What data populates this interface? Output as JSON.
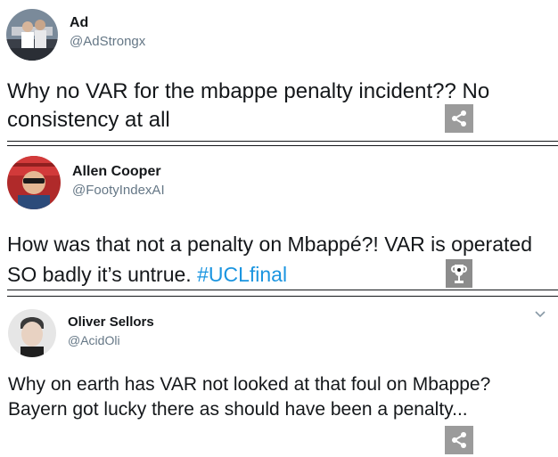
{
  "tweets": [
    {
      "name": "Ad",
      "handle": "@AdStrongx",
      "text": "Why no VAR for the mbappe penalty incident?? No consistency at all"
    },
    {
      "name": "Allen Cooper",
      "handle": "@FootyIndexAI",
      "text_before_hashtag": "How was that not a penalty on Mbappé?! VAR is operated SO badly it’s untrue. ",
      "hashtag": "#UCLfinal"
    },
    {
      "name": "Oliver Sellors",
      "handle": "@AcidOli",
      "text": "Why on earth has VAR not looked at that foul on Mbappe? Bayern got lucky there as should have been a penalty..."
    }
  ],
  "icons": {
    "share": "share-icon",
    "trophy": "trophy-icon",
    "chevron": "chevron-down-icon"
  },
  "colors": {
    "name": "#14171a",
    "handle": "#657786",
    "hashtag": "#1b95e0",
    "share_bg": "#9b9b9b"
  }
}
